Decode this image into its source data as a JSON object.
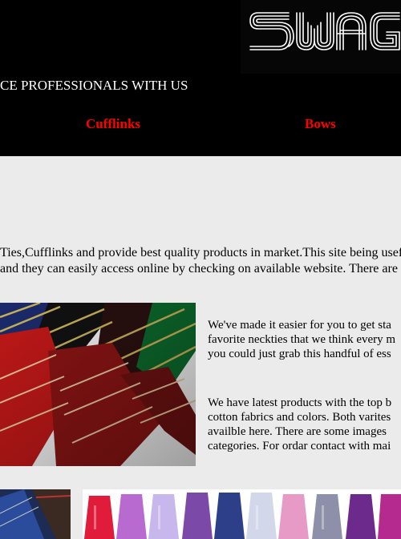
{
  "header": {
    "logo_text": "SWAG",
    "tagline": "CE PROFESSIONALS WITH US",
    "nav": [
      {
        "label": "Cufflinks"
      },
      {
        "label": "Bows"
      }
    ]
  },
  "intro": {
    "lines": [
      "Ties,Cufflinks and provide best quality products in market.This site being usef",
      "and they can easily access online by checking on available website. There are s"
    ]
  },
  "main": {
    "para1": [
      "We've made it easier for you to get sta",
      "favorite neckties that we think every m",
      "you could just grab this handful of ess"
    ],
    "para2": [
      "We have latest products with the top b",
      "cotton fabrics and colors. Both varites",
      "availble here. There are some images ",
      "categories. For ordar contact with mai"
    ]
  },
  "colors": {
    "header_bg": "#000000",
    "nav_link": "#ff0000",
    "page_bg": "#ebebeb"
  }
}
